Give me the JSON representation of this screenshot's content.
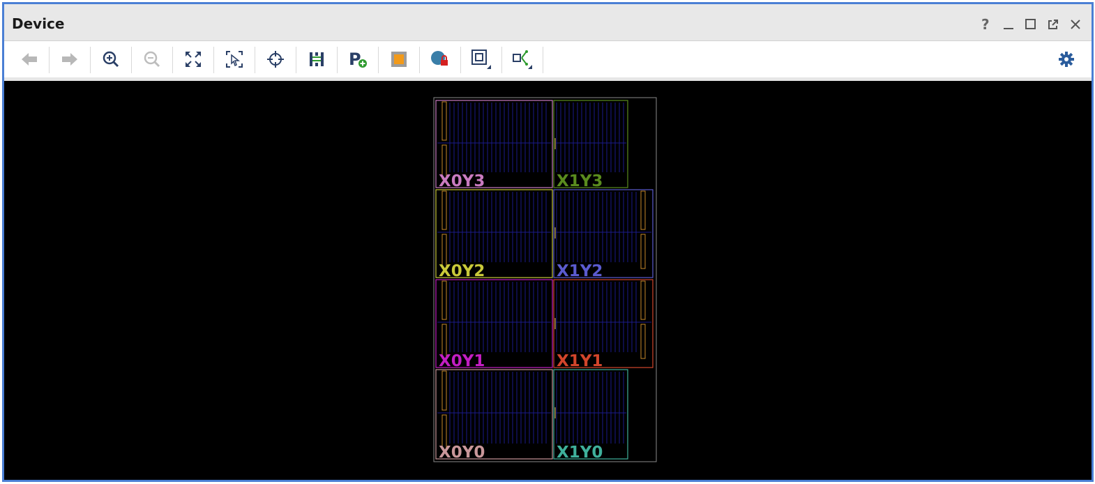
{
  "window": {
    "title": "Device",
    "controls": [
      "help-icon",
      "minimize-icon",
      "maximize-icon",
      "float-icon",
      "close-icon"
    ]
  },
  "toolbar": {
    "buttons": [
      {
        "name": "back",
        "icon": "arrow-left-icon",
        "enabled": false
      },
      {
        "name": "forward",
        "icon": "arrow-right-icon",
        "enabled": false
      },
      {
        "name": "zoom-in",
        "icon": "zoom-in-icon",
        "enabled": true
      },
      {
        "name": "zoom-out",
        "icon": "zoom-out-icon",
        "enabled": false
      },
      {
        "name": "zoom-fit",
        "icon": "fit-icon",
        "enabled": true
      },
      {
        "name": "zoom-selected",
        "icon": "select-zoom-icon",
        "enabled": true
      },
      {
        "name": "auto-fit-selection",
        "icon": "crosshair-icon",
        "enabled": true
      },
      {
        "name": "routing-resources",
        "icon": "routing-icon",
        "enabled": true
      },
      {
        "name": "create-pblock",
        "icon": "pblock-add-icon",
        "enabled": true
      },
      {
        "name": "show-cells",
        "icon": "cell-icon",
        "enabled": true
      },
      {
        "name": "fix-cells",
        "icon": "lock-cell-icon",
        "enabled": true
      },
      {
        "name": "show-regions",
        "icon": "region-icon",
        "enabled": true
      },
      {
        "name": "net-view",
        "icon": "nets-icon",
        "enabled": true
      }
    ],
    "settings_icon": "gear-icon"
  },
  "device": {
    "regions": [
      {
        "label": "X0Y3",
        "color": "#c97bc0"
      },
      {
        "label": "X1Y3",
        "color": "#5a8c1e"
      },
      {
        "label": "X0Y2",
        "color": "#c9c93a"
      },
      {
        "label": "X1Y2",
        "color": "#5b5bcf"
      },
      {
        "label": "X0Y1",
        "color": "#c21ec2"
      },
      {
        "label": "X1Y1",
        "color": "#d2452b"
      },
      {
        "label": "X0Y0",
        "color": "#c9979a"
      },
      {
        "label": "X1Y0",
        "color": "#3fb09b"
      }
    ]
  },
  "colors": {
    "accent": "#4a7fd4",
    "column_fill": "#1a1a8a",
    "io_column": "#c98a2a",
    "canvas": "#000000"
  }
}
